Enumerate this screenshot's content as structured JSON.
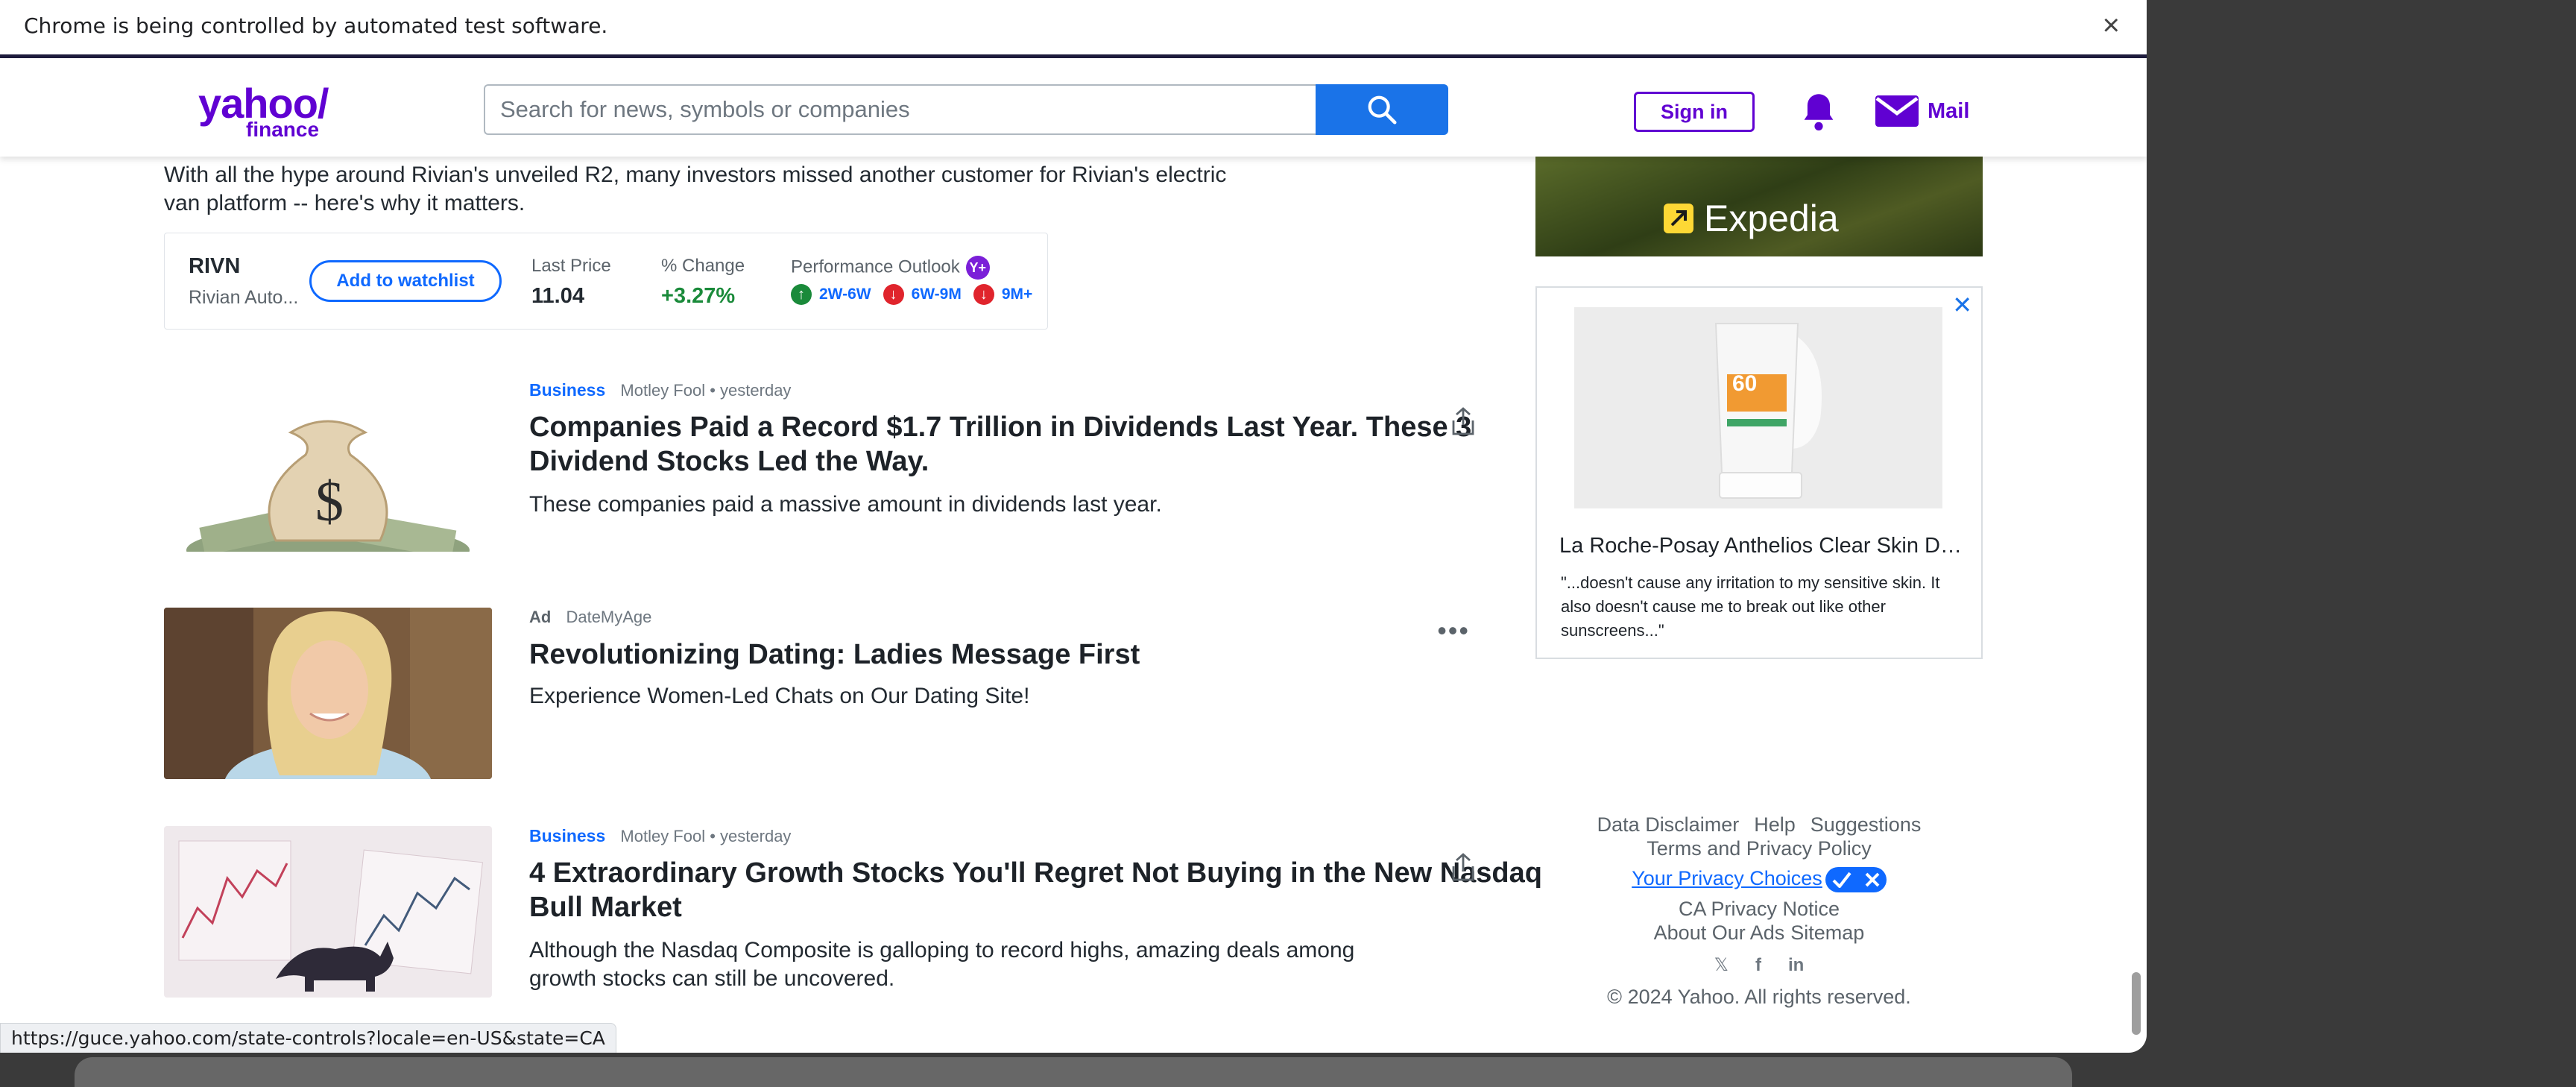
{
  "infobar": {
    "message": "Chrome is being controlled by automated test software.",
    "close": "×"
  },
  "header": {
    "logo_primary": "yahoo/",
    "logo_secondary": "finance",
    "search_placeholder": "Search for news, symbols or companies",
    "signin_label": "Sign in",
    "mail_label": "Mail"
  },
  "lede": "With all the hype around Rivian's unveiled R2, many investors missed another customer for Rivian's electric van platform -- here's why it matters.",
  "quote": {
    "symbol": "RIVN",
    "name": "Rivian Auto...",
    "watchlist_label": "Add to watchlist",
    "last_price_label": "Last Price",
    "last_price": "11.04",
    "pct_change_label": "% Change",
    "pct_change": "+3.27%",
    "outlook_label": "Performance Outlook",
    "outlook_badge": "Y+",
    "outlooks": [
      {
        "direction": "up",
        "label": "2W-6W"
      },
      {
        "direction": "down",
        "label": "6W-9M"
      },
      {
        "direction": "down",
        "label": "9M+"
      }
    ]
  },
  "stories": [
    {
      "category": "Business",
      "source": "Motley Fool",
      "time": "yesterday",
      "headline": "Companies Paid a Record $1.7 Trillion in Dividends Last Year. These 3 Dividend Stocks Led the Way.",
      "summary": "These companies paid a massive amount in dividends last year."
    },
    {
      "ad_label": "Ad",
      "source": "DateMyAge",
      "headline": "Revolutionizing Dating: Ladies Message First",
      "summary": "Experience Women-Led Chats on Our Dating Site!"
    },
    {
      "category": "Business",
      "source": "Motley Fool",
      "time": "yesterday",
      "headline": "4 Extraordinary Growth Stocks You'll Regret Not Buying in the New Nasdaq Bull Market",
      "summary": "Although the Nasdaq Composite is galloping to record highs, amazing deals among growth stocks can still be uncovered."
    }
  ],
  "ads": {
    "expedia": "Expedia",
    "product_title": "La Roche-Posay Anthelios Clear Skin Dr...",
    "product_desc": "\"...doesn't cause any irritation to my sensitive skin. It also doesn't cause me to break out like other sunscreens...\"",
    "product_badge": "60"
  },
  "footer": {
    "data_disclaimer": "Data Disclaimer",
    "help": "Help",
    "suggestions": "Suggestions",
    "terms": "Terms and Privacy Policy",
    "privacy_choices": "Your Privacy Choices",
    "ca_notice": "CA Privacy Notice",
    "about_ads": "About Our Ads",
    "sitemap": "Sitemap",
    "copyright": "© 2024 Yahoo. All rights reserved."
  },
  "status_url": "https://guce.yahoo.com/state-controls?locale=en-US&state=CA",
  "colors": {
    "brand": "#6001d2",
    "link": "#0f69ff",
    "positive": "#1a8a3a",
    "negative": "#e0242c"
  }
}
